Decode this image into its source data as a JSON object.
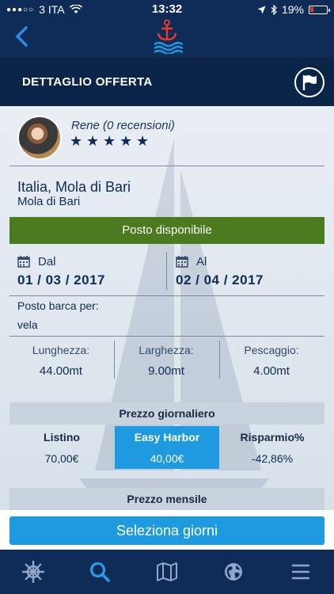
{
  "status": {
    "carrier": "3 ITA",
    "time": "13:32",
    "battery": "19%",
    "battery_level": 0.19
  },
  "nav": {
    "back_icon": "chevron-left-icon",
    "logo_icon": "anchor-waves-icon"
  },
  "header": {
    "title": "DETTAGLIO OFFERTA",
    "flag_icon": "flag-icon"
  },
  "user": {
    "name": "Rene (0 recensioni)",
    "rating": 5
  },
  "location": {
    "line1": "Italia, Mola di Bari",
    "line2": "Mola di Bari"
  },
  "availability": "Posto disponibile",
  "dates": {
    "from_label": "Dal",
    "from_value": "01 / 03 / 2017",
    "to_label": "Al",
    "to_value": "02 / 04 / 2017"
  },
  "boat": {
    "label": "Posto barca per:",
    "value": "vela"
  },
  "dimensions": [
    {
      "label": "Lunghezza:",
      "value": "44.00mt"
    },
    {
      "label": "Larghezza:",
      "value": "9.00mt"
    },
    {
      "label": "Pescaggio:",
      "value": "4.00mt"
    }
  ],
  "price": {
    "daily_title": "Prezzo giornaliero",
    "columns": [
      {
        "header": "Listino",
        "value": "70,00€"
      },
      {
        "header": "Easy Harbor",
        "value": "40,00€"
      },
      {
        "header": "Risparmio%",
        "value": "-42,86%"
      }
    ],
    "monthly_title": "Prezzo mensile"
  },
  "cta": "Seleziona giorni",
  "tabs": [
    "helm-icon",
    "search-icon",
    "map-icon",
    "globe-icon",
    "menu-icon"
  ],
  "colors": {
    "navy": "#0f2b57",
    "accent": "#1e9be0",
    "available": "#4c7a1e"
  }
}
